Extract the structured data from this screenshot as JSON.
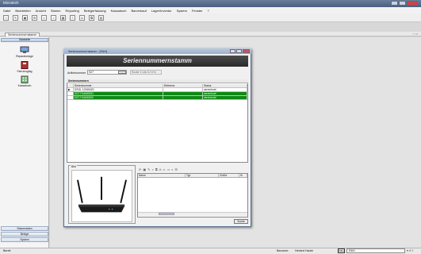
{
  "app": {
    "title": "Microtech",
    "colors": {
      "titlebar": "#4a5f7e",
      "selection": "#0d8a12",
      "banner": "#2a2a2a"
    }
  },
  "menu": [
    "Datei",
    "Bearbeiten",
    "Ansicht",
    "Stamm",
    "Reporting",
    "Belegerfassung",
    "Kassabuch",
    "Barverkauf",
    "Lager/Inventur",
    "System",
    "Fenster",
    "?"
  ],
  "toolbar_icons": [
    "new-icon",
    "edit-icon",
    "save-icon",
    "settings-icon",
    "search-icon",
    "delete-icon",
    "calculator-icon",
    "text-icon",
    "a-icon",
    "copy-icon",
    "table-icon"
  ],
  "tab": {
    "label": "Seriennummernstamm"
  },
  "pagenav": "‹ › ×",
  "sidebar": {
    "header": "Startseite",
    "items": [
      {
        "label": "Reparaturtage",
        "icon": "monitor-icon"
      },
      {
        "label": "Fahrzeugtag",
        "icon": "book-icon"
      },
      {
        "label": "Kassabuch",
        "icon": "building-icon"
      }
    ],
    "bottom": [
      "Stammdaten",
      "Belege",
      "System"
    ]
  },
  "dialog": {
    "title": "Seriennummernstamm - [R&H]",
    "banner": "Seriennummernstamm",
    "article_label": "Artikelnummer",
    "article_value": "927",
    "article_desc": "Router 3 Link D-H.Hn",
    "grid": {
      "caption": "Seriennummern",
      "columns": [
        "Seriennummer",
        "Referenz",
        "Status"
      ],
      "rows": [
        {
          "marker": "▶",
          "serial": "DSGL 12345420",
          "ref": "",
          "status": "verrechnet",
          "selected": false
        },
        {
          "marker": "",
          "serial": "DS7 F44600001",
          "ref": "",
          "status": "verrechnet",
          "selected": true
        },
        {
          "marker": "",
          "serial": "DS7 F44600002",
          "ref": "",
          "status": "verrechnet",
          "selected": true
        }
      ]
    },
    "bild_label": "Bild",
    "docs": {
      "columns": [
        "Name",
        "Typ",
        "Größe",
        "Ki"
      ]
    },
    "search_button": "Suche"
  },
  "status": {
    "left": "Bereit",
    "benutzer_label": "Benutzer:",
    "user": "Herbert Haubt",
    "logo": "R&H",
    "combo": "R&H",
    "icons": "▾ ∂ ≡"
  }
}
